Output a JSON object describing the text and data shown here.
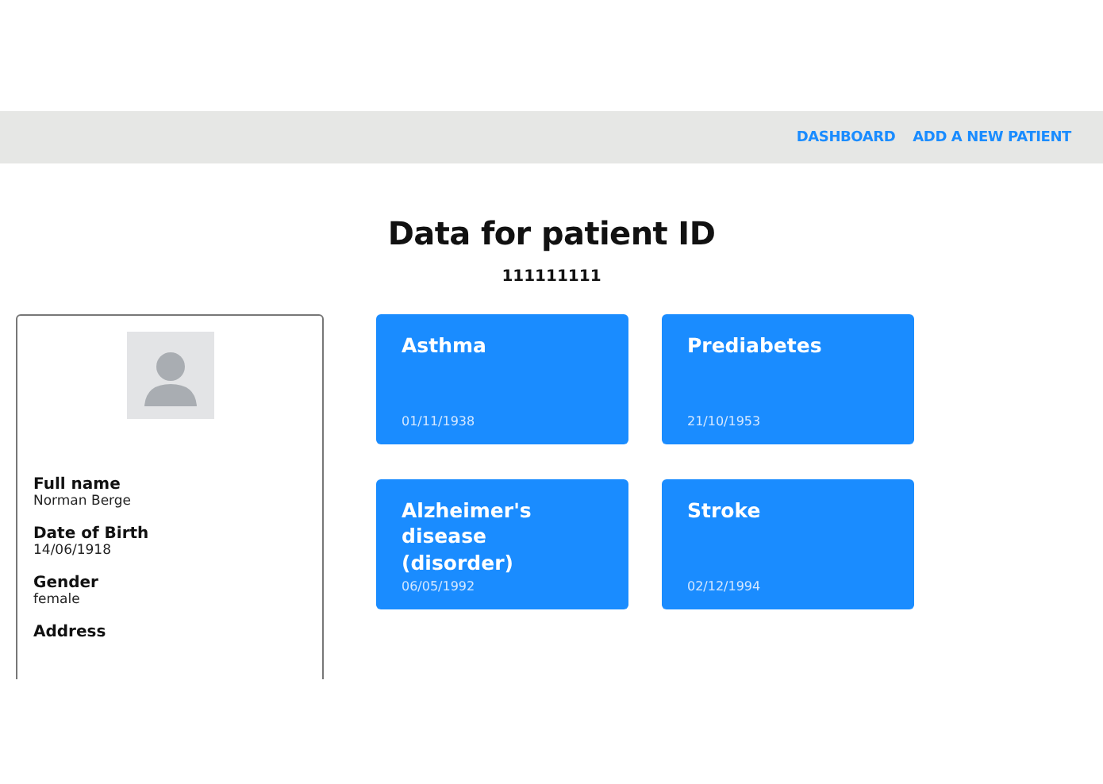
{
  "nav": {
    "links": [
      {
        "label": "DASHBOARD"
      },
      {
        "label": "ADD A NEW PATIENT"
      }
    ]
  },
  "heading": {
    "title": "Data for patient ID",
    "patient_id": "111111111"
  },
  "profile": {
    "fields": [
      {
        "label": "Full name",
        "value": "Norman Berge"
      },
      {
        "label": "Date of Birth",
        "value": "14/06/1918"
      },
      {
        "label": "Gender",
        "value": "female"
      },
      {
        "label": "Address"
      }
    ]
  },
  "conditions": [
    {
      "name": "Asthma",
      "date": "01/11/1938"
    },
    {
      "name": "Prediabetes",
      "date": "21/10/1953"
    },
    {
      "name": "Alzheimer's disease (disorder)",
      "date": "06/05/1992"
    },
    {
      "name": "Stroke",
      "date": "02/12/1994"
    }
  ]
}
